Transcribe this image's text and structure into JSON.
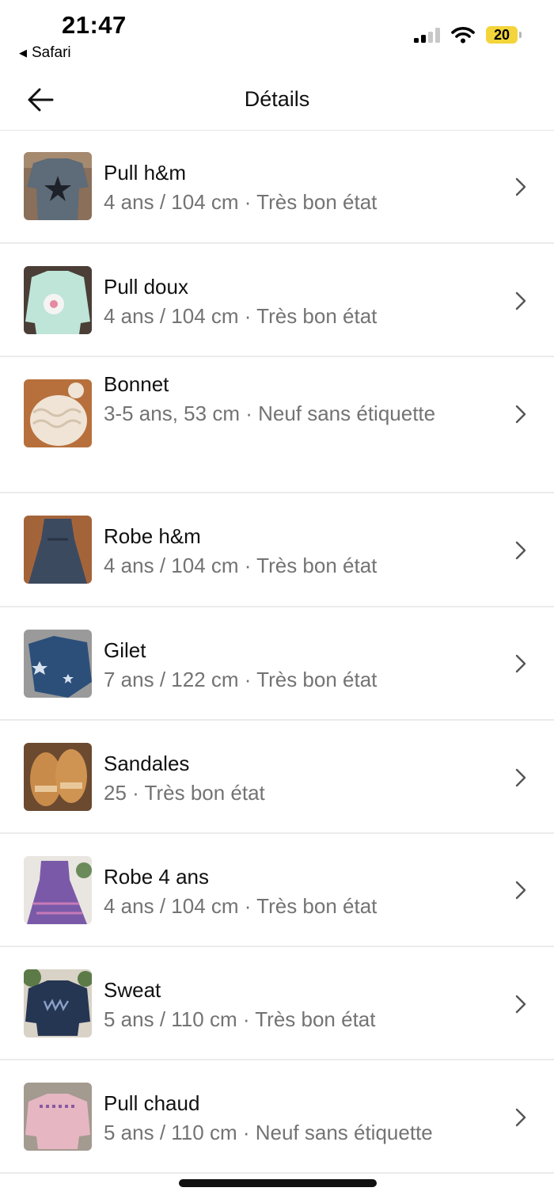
{
  "status_bar": {
    "time": "21:47",
    "back_app": "Safari",
    "battery": "20",
    "icons": [
      "cellular-signal-icon",
      "wifi-icon",
      "battery-icon"
    ]
  },
  "header": {
    "title": "Détails",
    "back_icon": "arrow-left-icon"
  },
  "items": [
    {
      "title": "Pull h&m",
      "subtitle": "4 ans / 104 cm · Très bon état"
    },
    {
      "title": "Pull doux",
      "subtitle": "4 ans / 104 cm · Très bon état"
    },
    {
      "title": "Bonnet",
      "subtitle": "3-5 ans, 53 cm · Neuf sans étiquette"
    },
    {
      "title": "Robe h&m",
      "subtitle": "4 ans / 104 cm · Très bon état"
    },
    {
      "title": "Gilet",
      "subtitle": "7 ans / 122 cm · Très bon état"
    },
    {
      "title": "Sandales",
      "subtitle": "25 · Très bon état"
    },
    {
      "title": "Robe 4 ans",
      "subtitle": "4 ans / 104 cm · Très bon état"
    },
    {
      "title": "Sweat",
      "subtitle": "5 ans / 110 cm · Très bon état"
    },
    {
      "title": "Pull chaud",
      "subtitle": "5 ans / 110 cm · Neuf sans étiquette"
    }
  ],
  "colors": {
    "title_text": "#111111",
    "subtitle_text": "#737373",
    "divider": "#ebebeb",
    "battery_fill": "#f3d43a"
  }
}
